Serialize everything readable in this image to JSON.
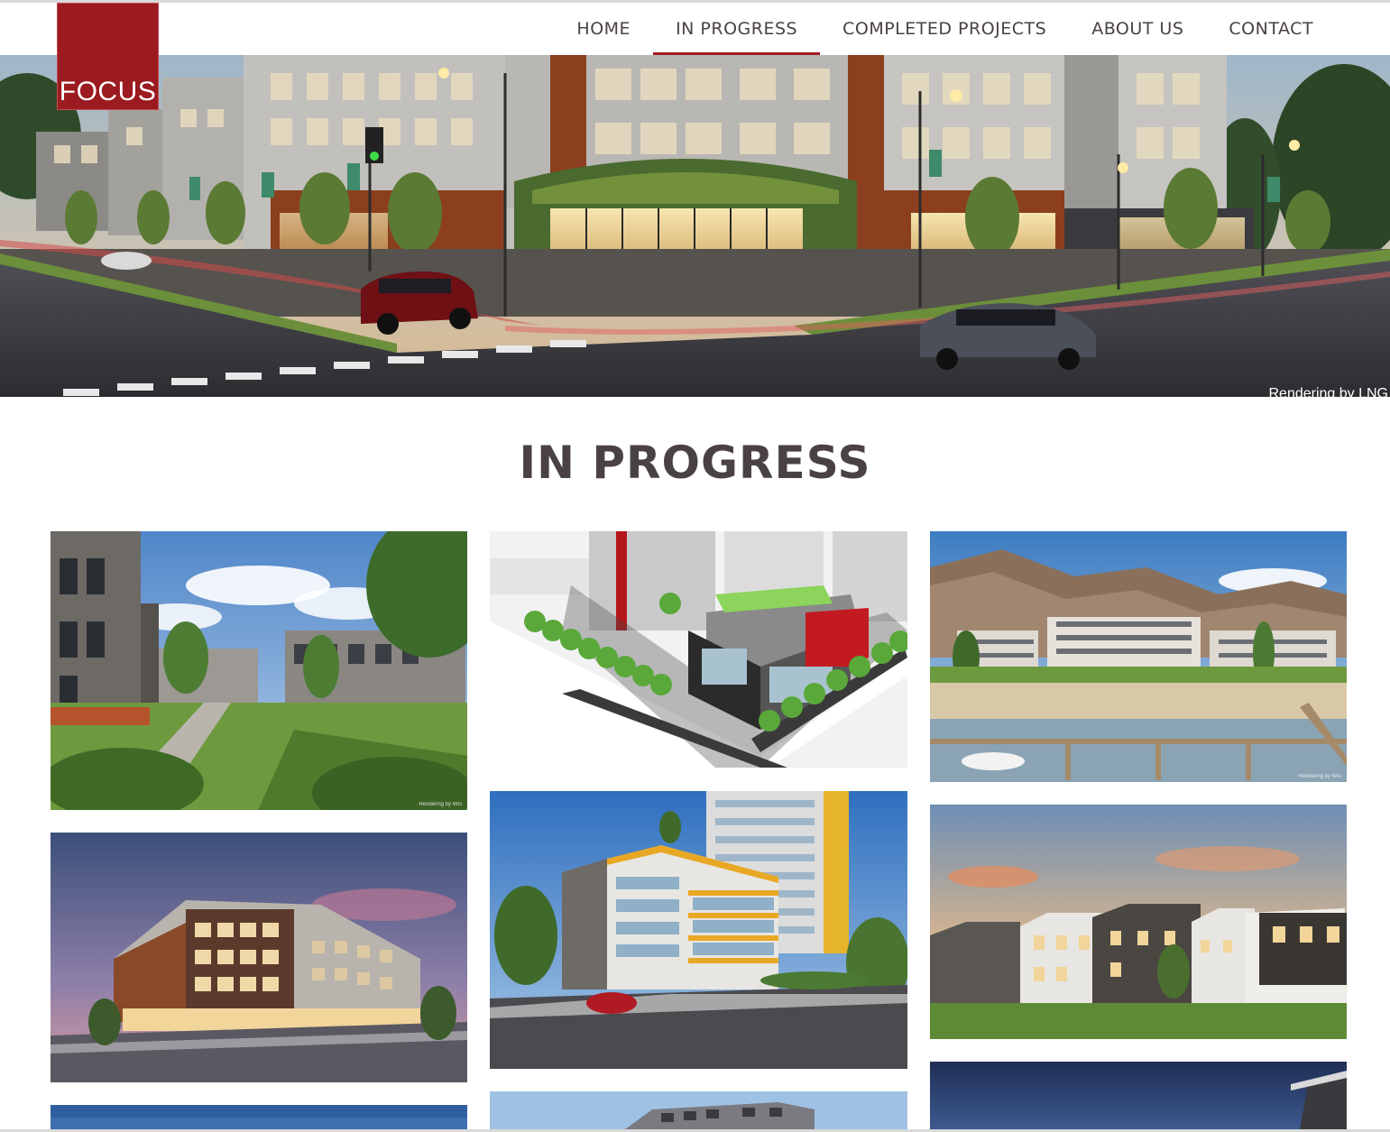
{
  "brand": {
    "logo_text": "FOCUS",
    "color": "#9b1b20"
  },
  "nav": {
    "items": [
      {
        "label": "HOME",
        "active": false
      },
      {
        "label": "IN PROGRESS",
        "active": true
      },
      {
        "label": "COMPLETED PROJECTS",
        "active": false
      },
      {
        "label": "ABOUT US",
        "active": false
      },
      {
        "label": "CONTACT",
        "active": false
      }
    ],
    "active_color": "#a01c22"
  },
  "hero": {
    "credit": "Rendering by LNG"
  },
  "section": {
    "title": "IN PROGRESS"
  },
  "projects": {
    "tile_credits": {
      "townhome_courtyard": "Rendering by WG",
      "lakefront": "Rendering by WG"
    }
  }
}
